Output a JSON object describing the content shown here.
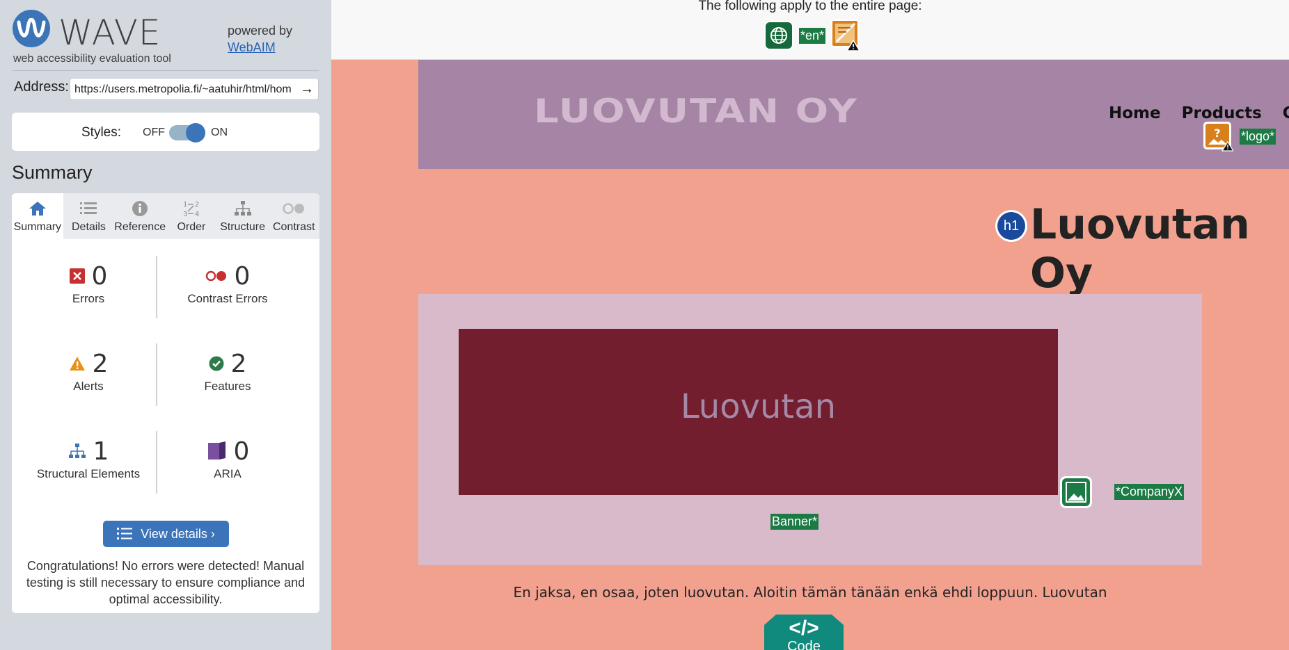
{
  "sidebar": {
    "logo_word": "WAVE",
    "tagline": "web accessibility evaluation tool",
    "powered_by": "powered by",
    "powered_link": "WebAIM",
    "address_label": "Address:",
    "address_value": "https://users.metropolia.fi/~aatuhir/html/hom",
    "styles_label": "Styles:",
    "toggle_off": "OFF",
    "toggle_on": "ON",
    "summary_heading": "Summary",
    "tabs": [
      {
        "label": "Summary",
        "icon": "home-icon"
      },
      {
        "label": "Details",
        "icon": "list-icon"
      },
      {
        "label": "Reference",
        "icon": "info-icon"
      },
      {
        "label": "Order",
        "icon": "order-icon"
      },
      {
        "label": "Structure",
        "icon": "structure-icon"
      },
      {
        "label": "Contrast",
        "icon": "contrast-icon"
      }
    ],
    "stats": {
      "errors": {
        "value": "0",
        "label": "Errors"
      },
      "contrast_errors": {
        "value": "0",
        "label": "Contrast Errors"
      },
      "alerts": {
        "value": "2",
        "label": "Alerts"
      },
      "features": {
        "value": "2",
        "label": "Features"
      },
      "structural": {
        "value": "1",
        "label": "Structural Elements"
      },
      "aria": {
        "value": "0",
        "label": "ARIA"
      }
    },
    "view_details": "View details ›",
    "congrats": "Congratulations! No errors were detected! Manual testing is still necessary to ensure compliance and optimal accessibility."
  },
  "main": {
    "pagewide_text": "The following apply to the entire page:",
    "lang_tag": "*en*",
    "site_logo": "LUOVUTAN OY",
    "logo_tag": "*logo*",
    "nav": [
      "Home",
      "Products",
      "Conta"
    ],
    "h1_badge": "h1",
    "heading": "Luovutan Oy",
    "banner_text": "Luovutan",
    "company_tag": "*CompanyX",
    "banner_tag": "Banner*",
    "paragraph": "En jaksa, en osaa, joten luovutan. Aloitin tämän tänään enkä ehdi loppuun. Luovutan",
    "code_symbol": "</>",
    "code_label": "Code"
  },
  "colors": {
    "wave_blue": "#3b74b8",
    "feature_green": "#1c7a45",
    "error_red": "#c0392b",
    "alert_orange": "#e8901a",
    "page_bg": "#f2a18f",
    "header_bg": "#a584a5",
    "banner_bg": "#731e2e"
  }
}
